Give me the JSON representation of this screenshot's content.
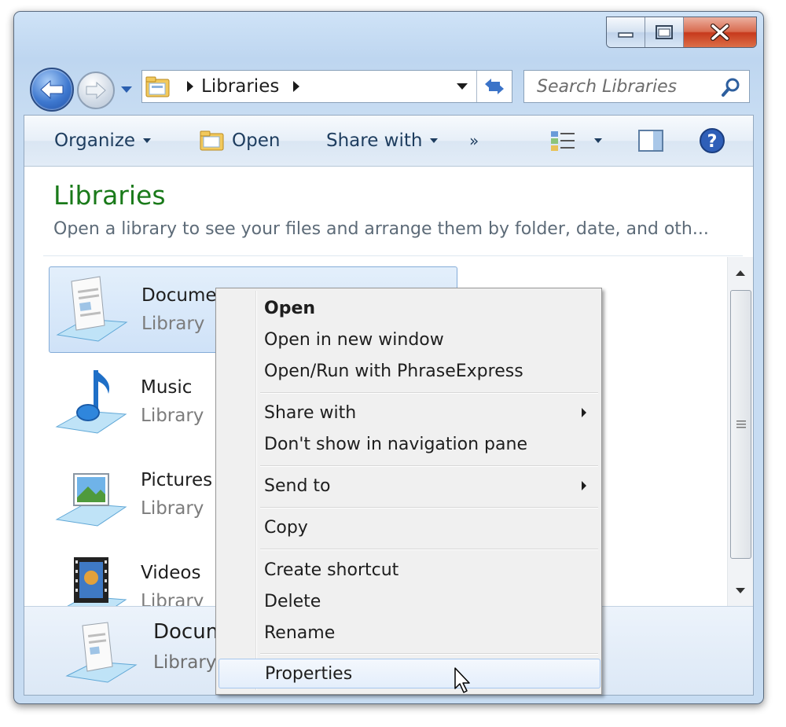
{
  "addressbar": {
    "crumb": "Libraries"
  },
  "search": {
    "placeholder": "Search Libraries"
  },
  "toolbar": {
    "organize": "Organize",
    "open": "Open",
    "share_with": "Share with",
    "more": "»"
  },
  "header": {
    "title": "Libraries",
    "description": "Open a library to see your files and arrange them by folder, date, and oth..."
  },
  "libraries": [
    {
      "name": "Documents",
      "type": "Library",
      "icon": "documents-library-icon"
    },
    {
      "name": "Music",
      "type": "Library",
      "icon": "music-library-icon"
    },
    {
      "name": "Pictures",
      "type": "Library",
      "icon": "pictures-library-icon"
    },
    {
      "name": "Videos",
      "type": "Library",
      "icon": "videos-library-icon"
    }
  ],
  "details": {
    "name": "Documents",
    "type": "Library"
  },
  "context_menu": {
    "items": [
      {
        "label": "Open",
        "bold": true
      },
      {
        "label": "Open in new window"
      },
      {
        "label": "Open/Run with PhraseExpress"
      },
      {
        "label": "Share with",
        "submenu": true
      },
      {
        "label": "Don't show in navigation pane"
      },
      {
        "label": "Send to",
        "submenu": true
      },
      {
        "label": "Copy"
      },
      {
        "label": "Create shortcut"
      },
      {
        "label": "Delete"
      },
      {
        "label": "Rename"
      },
      {
        "label": "Properties",
        "hover": true
      }
    ]
  },
  "colors": {
    "title_green": "#1a7a1a",
    "accent_blue": "#3e78cf",
    "selection": "#cfe2f8"
  }
}
